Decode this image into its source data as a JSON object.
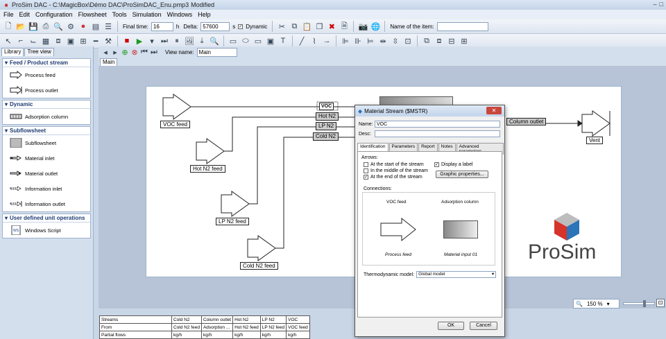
{
  "window": {
    "title": "ProSim DAC - C:\\MagicBox\\Démo DAC\\ProSimDAC_Enu.pmp3",
    "status": "Modified"
  },
  "menu": [
    "File",
    "Edit",
    "Configuration",
    "Flowsheet",
    "Tools",
    "Simulation",
    "Windows",
    "Help"
  ],
  "toolbar": {
    "final_time_label": "Final time:",
    "final_time": "16",
    "final_time_unit": "h",
    "delta_label": "Delta:",
    "delta": "57600",
    "delta_unit": "s",
    "dynamic_label": "Dynamic",
    "name_of_item_label": "Name of the item:",
    "name_of_item": ""
  },
  "viewbar": {
    "view_name_label": "View name:",
    "view_name": "Main"
  },
  "doc_tab": "Main",
  "library": {
    "tabs": [
      "Library",
      "Tree view"
    ],
    "sections": [
      {
        "title": "Feed / Product stream",
        "items": [
          "Process feed",
          "Process outlet"
        ]
      },
      {
        "title": "Dynamic",
        "items": [
          "Adsorption column"
        ]
      },
      {
        "title": "Subflowsheet",
        "items": [
          "Subflowsheet",
          "Material inlet",
          "Material outlet",
          "Information inlet",
          "Information outlet"
        ]
      },
      {
        "title": "User defined unit operations",
        "items": [
          "Windows Script"
        ]
      }
    ]
  },
  "flowsheet": {
    "feeds": [
      "VOC feed",
      "Hot N2 feed",
      "LP N2 feed",
      "Cold N2 feed"
    ],
    "stream_labels": [
      "VOC",
      "Hot N2",
      "LP N2",
      "Cold N2"
    ],
    "outlet_label": "Column outlet",
    "vent": "Vent"
  },
  "logo": "ProSim",
  "dialog": {
    "title": "Material Stream ($MSTR)",
    "name_label": "Name:",
    "name_value": "VOC",
    "desc_label": "Desc:",
    "tabs": [
      "Identification",
      "Parameters",
      "Report",
      "Notes",
      "Advanced parameters"
    ],
    "arrows_label": "Arrows:",
    "arrow_options": [
      {
        "label": "At the start of the stream",
        "checked": false
      },
      {
        "label": "In the middle of the stream",
        "checked": false
      },
      {
        "label": "At the end of the stream",
        "checked": true
      }
    ],
    "display_label": "Display a label",
    "graphic_btn": "Graphic properties...",
    "connections_label": "Connections:",
    "from_name": "VOC feed",
    "to_name": "Adsorption column",
    "from_type": "Process feed",
    "to_type": "Material input 01",
    "thermo_label": "Thermodynamic model:",
    "thermo_value": "Global model",
    "ok": "OK",
    "cancel": "Cancel"
  },
  "zoom": "150 %",
  "table": {
    "rows": [
      [
        "Streams",
        "Cold N2",
        "Column outlet",
        "Hot N2",
        "LP N2",
        "VOC"
      ],
      [
        "From",
        "Cold N2 feed",
        "Adsorption ...",
        "Hot N2 feed",
        "LP N2 feed",
        "VOC feed"
      ],
      [
        "Partial flows",
        "kg/h",
        "kg/h",
        "kg/h",
        "kg/h",
        "kg/h"
      ]
    ]
  }
}
